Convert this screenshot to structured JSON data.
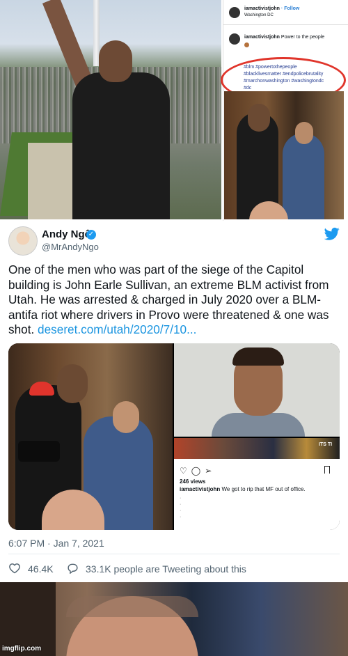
{
  "instagram_top": {
    "username": "iamactivistjohn",
    "follow": "Follow",
    "location": "Washington DC",
    "caption_user": "iamactivistjohn",
    "caption_text": "Power to the people",
    "hashtags": [
      "#blm #powertothepeople",
      "#blacklivesmatter #endpolicebrutality",
      "#marchonwashington #washingtondc",
      "#dc"
    ],
    "highlight_color": "#e0352b"
  },
  "tweet": {
    "display_name": "Andy Ngô",
    "handle": "@MrAndyNgo",
    "text": "One of the men who was part of the siege of the Capitol building is John Earle Sullivan, an extreme BLM activist from Utah. He was arrested & charged in July 2020 over a BLM-antifa riot where drivers in Provo were threatened & one was shot.",
    "link": "deseret.com/utah/2020/7/10...",
    "timestamp": "6:07 PM · Jan 7, 2021",
    "likes": "46.4K",
    "tweeting": "33.1K people are Tweeting about this",
    "accent_color": "#1d9bf0",
    "icons": [
      "verified-badge-icon",
      "twitter-bird-icon",
      "heart-icon",
      "speech-bubble-icon"
    ]
  },
  "embedded_instagram": {
    "banner_text": "ITS TI",
    "views": "246 views",
    "caption_user": "iamactivistjohn",
    "caption_text": "We got to rip that MF out of office."
  },
  "watermark": "imgflip.com"
}
